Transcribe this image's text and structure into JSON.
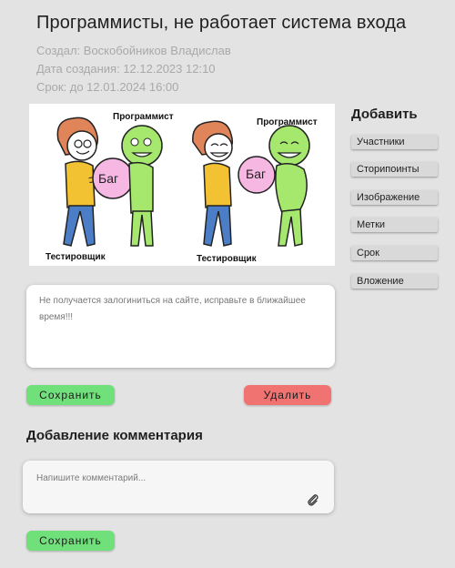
{
  "task": {
    "title": "Программисты, не работает система входа",
    "author": "Создал: Воскобойников Владислав",
    "created": "Дата создания: 12.12.2023 12:10",
    "deadline": "Срок: до 12.01.2024 16:00"
  },
  "image": {
    "left_panel": {
      "top_label": "Программист",
      "bottom_label": "Тестировщик",
      "ball_text": "Баг"
    },
    "right_panel": {
      "top_label": "Программист",
      "bottom_label": "Тестировщик",
      "ball_text": "Баг"
    }
  },
  "sidebar": {
    "title": "Добавить",
    "items": [
      {
        "label": "Участники"
      },
      {
        "label": "Сторипоинты"
      },
      {
        "label": "Изображение"
      },
      {
        "label": "Метки"
      },
      {
        "label": "Срок"
      },
      {
        "label": "Вложение"
      }
    ]
  },
  "description": {
    "text": "Не получается залогиниться на сайте, исправьте в ближайшее время!!!"
  },
  "actions": {
    "save_label": "Сохранить",
    "delete_label": "Удалить"
  },
  "comments": {
    "section_title": "Добавление комментария",
    "placeholder": "Напишите комментарий...",
    "save_label": "Сохранить"
  },
  "icons": {
    "attach": "paperclip-icon"
  },
  "colors": {
    "save_green": "#6fe07a",
    "delete_red": "#f07372",
    "background": "#e3e3e3"
  }
}
